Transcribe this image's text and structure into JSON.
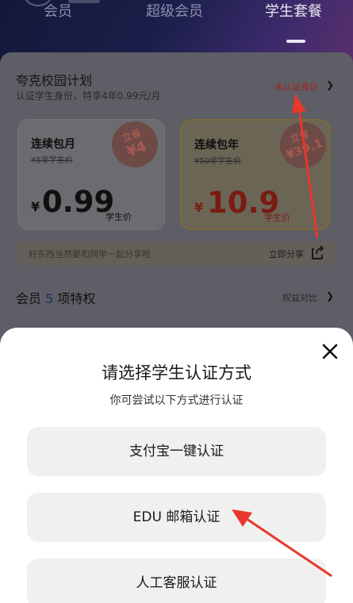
{
  "tabs": [
    "会员",
    "超级会员",
    "学生套餐"
  ],
  "plan": {
    "title": "夸克校园计划",
    "subtitle": "认证学生身份，特享4年0.99元/月",
    "status": "未认证身份"
  },
  "cards": [
    {
      "name": "连续包月",
      "orig": "¥5非学生价",
      "currency": "¥",
      "price": "0.99",
      "unit": "学生价",
      "stamp_top": "立省",
      "stamp_bottom": "¥4"
    },
    {
      "name": "连续包年",
      "orig": "¥50非学生价",
      "currency": "¥",
      "price": "10.9",
      "unit": "学生价",
      "stamp_top": "立省",
      "stamp_bottom": "¥39.1"
    }
  ],
  "share": {
    "tip": "好东西当然要和同学一起分享啦",
    "button": "立即分享"
  },
  "privileges": {
    "prefix": "会员",
    "count": "5",
    "suffix": "项特权",
    "compare": "权益对比"
  },
  "sheet": {
    "title": "请选择学生认证方式",
    "subtitle": "你可尝试以下方式进行认证",
    "options": [
      "支付宝一键认证",
      "EDU 邮箱认证",
      "人工客服认证"
    ]
  },
  "colors": {
    "accent_red": "#e8382c",
    "sheet_bg": "#ffffff",
    "option_bg": "#f0f0f0"
  }
}
